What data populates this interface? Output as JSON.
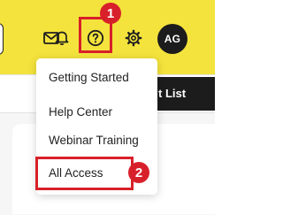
{
  "header": {
    "avatar_initials": "AG",
    "icons": {
      "mail": "mail-icon",
      "notifications": "bell-icon",
      "help": "help-circle-icon",
      "settings": "gear-icon"
    },
    "accent_color": "#f4e33c"
  },
  "action_button": {
    "label": "t List"
  },
  "help_menu": {
    "items": [
      {
        "label": "Getting Started"
      },
      {
        "label": "Help Center"
      },
      {
        "label": "Webinar Training"
      },
      {
        "label": "All Access"
      }
    ]
  },
  "annotations": {
    "step_1": "1",
    "step_2": "2",
    "highlight_color": "#d8202a"
  }
}
